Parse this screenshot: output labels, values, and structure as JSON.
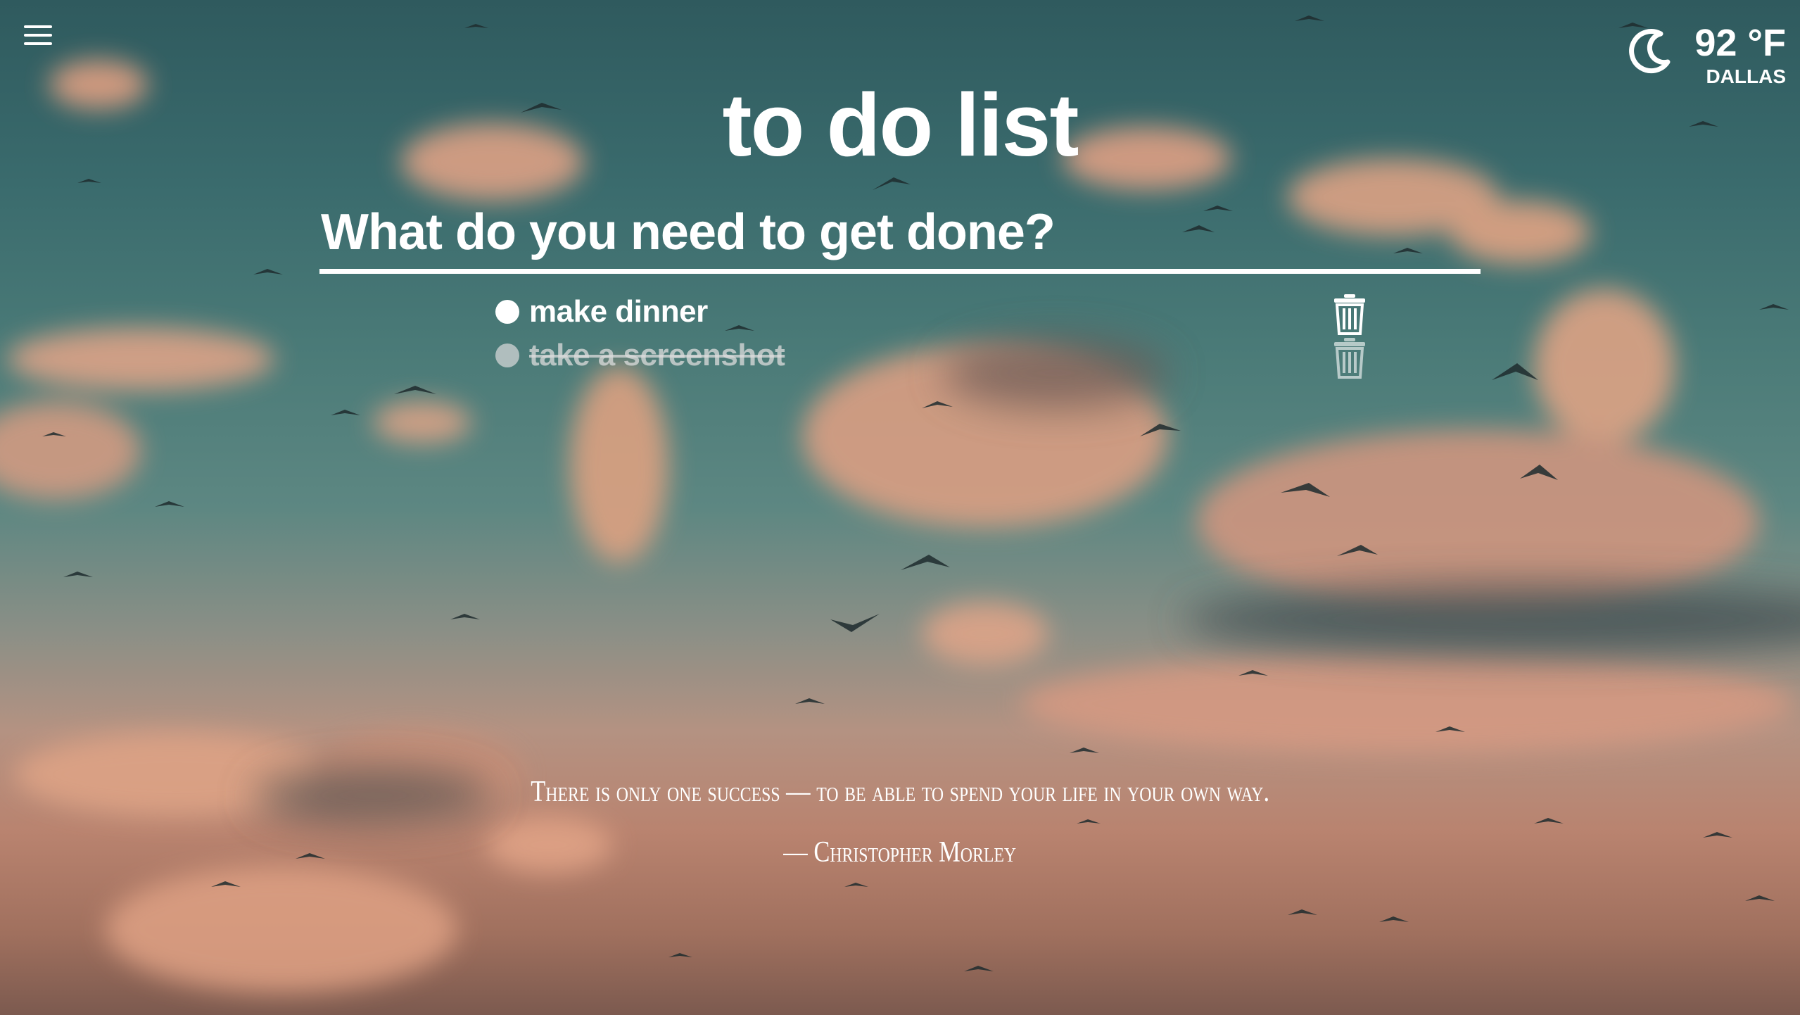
{
  "app": {
    "title": "to do list"
  },
  "menu": {
    "icon": "hamburger-menu-icon"
  },
  "weather": {
    "icon": "weather-moon-icon",
    "temperature": "92 °F",
    "city": "DALLAS"
  },
  "input": {
    "placeholder": "What do you need to get done?",
    "value": ""
  },
  "todos": [
    {
      "text": "make dinner",
      "completed": false,
      "bullet_icon": "circle-icon",
      "delete_icon": "trash-icon"
    },
    {
      "text": "take a screenshot",
      "completed": true,
      "bullet_icon": "circle-icon",
      "delete_icon": "trash-icon"
    }
  ],
  "quote": {
    "text": "There is only one success — to be able to spend your life in your own way.",
    "author": "— Christopher Morley"
  },
  "theme": {
    "text_color": "#ffffff",
    "done_color": "#d6d6d6",
    "sky_top": "#2f5a5e",
    "sky_bottom": "#7c5a4f"
  }
}
